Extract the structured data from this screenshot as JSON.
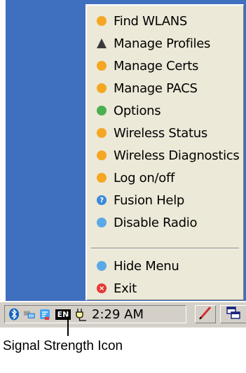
{
  "menu": {
    "items": [
      {
        "label": "Find WLANS",
        "icon": "find-wlans-icon",
        "color": "#f5a623"
      },
      {
        "label": "Manage Profiles",
        "icon": "manage-profiles-icon",
        "color": "#3a3a3a"
      },
      {
        "label": "Manage Certs",
        "icon": "manage-certs-icon",
        "color": "#f5a623"
      },
      {
        "label": "Manage PACS",
        "icon": "manage-pacs-icon",
        "color": "#f5a623"
      },
      {
        "label": "Options",
        "icon": "options-icon",
        "color": "#4caf50"
      },
      {
        "label": "Wireless Status",
        "icon": "wireless-status-icon",
        "color": "#f5a623"
      },
      {
        "label": "Wireless Diagnostics",
        "icon": "wireless-diagnostics-icon",
        "color": "#f5a623"
      },
      {
        "label": "Log on/off",
        "icon": "log-on-off-icon",
        "color": "#f5a623"
      },
      {
        "label": "Fusion Help",
        "icon": "fusion-help-icon",
        "color": "#3a8bd8"
      },
      {
        "label": "Disable Radio",
        "icon": "disable-radio-icon",
        "color": "#5aa9e6"
      }
    ],
    "bottom_items": [
      {
        "label": "Hide Menu",
        "icon": "hide-menu-icon",
        "color": "#5aa9e6"
      },
      {
        "label": "Exit",
        "icon": "exit-icon",
        "color": "#e53935"
      }
    ]
  },
  "taskbar": {
    "language": "EN",
    "clock": "2:29 AM"
  },
  "callout": {
    "label": "Signal Strength Icon"
  }
}
